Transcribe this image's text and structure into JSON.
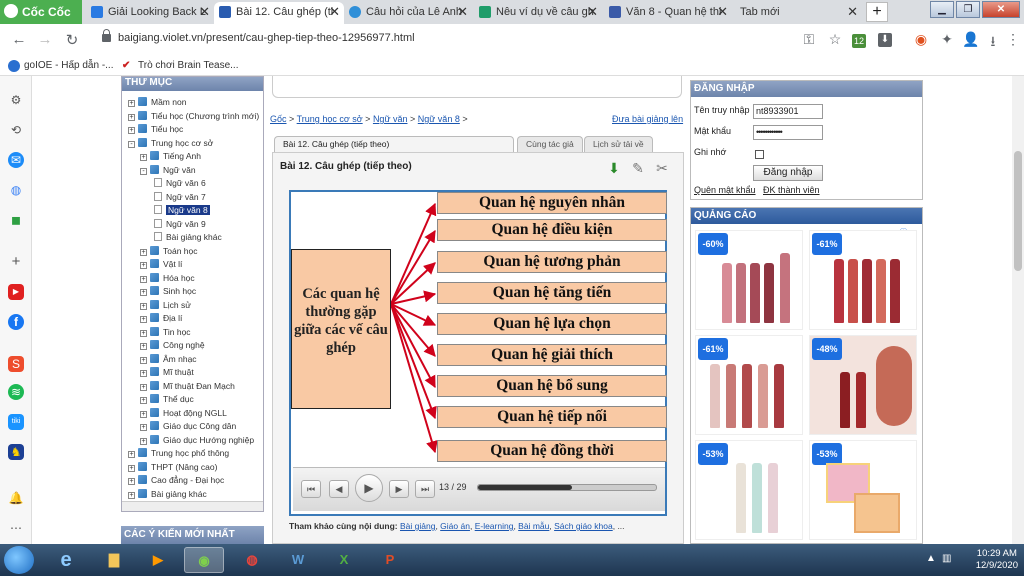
{
  "browser": {
    "brand": "Cốc Cốc",
    "tabs": [
      {
        "label": "Giải Looking Back L",
        "favicon_color": "#2a7ae2"
      },
      {
        "label": "Bài 12. Câu ghép (ti",
        "favicon_color": "#2a5cb0",
        "active": true
      },
      {
        "label": "Câu hỏi của Lê Anh",
        "favicon_color": "#2f8fd8"
      },
      {
        "label": "Nêu ví dụ về câu gh",
        "favicon_color": "#1f9d6a"
      },
      {
        "label": "Văn 8 - Quan hệ thi",
        "favicon_color": "#3a5aa8"
      },
      {
        "label": "Tab mới",
        "favicon_color": ""
      }
    ],
    "new_tab": "+",
    "url": "baigiang.violet.vn/present/cau-ghep-tiep-theo-12956977.html",
    "bookmarks": [
      {
        "label": "goIOE - Hấp dẫn -..."
      },
      {
        "label": "Trò chơi Brain Tease..."
      }
    ],
    "bookmark_counter": "12"
  },
  "directory": {
    "title": "THƯ MỤC",
    "items": [
      {
        "label": "Mầm non",
        "level": 0,
        "exp": "+"
      },
      {
        "label": "Tiểu học (Chương trình mới)",
        "level": 0,
        "exp": "+"
      },
      {
        "label": "Tiểu học",
        "level": 0,
        "exp": "+"
      },
      {
        "label": "Trung học cơ sở",
        "level": 0,
        "exp": "-"
      },
      {
        "label": "Tiếng Anh",
        "level": 1,
        "exp": "+"
      },
      {
        "label": "Ngữ văn",
        "level": 1,
        "exp": "-"
      },
      {
        "label": "Ngữ văn 6",
        "level": 2,
        "exp": ""
      },
      {
        "label": "Ngữ văn 7",
        "level": 2,
        "exp": ""
      },
      {
        "label": "Ngữ văn 8",
        "level": 2,
        "exp": "",
        "selected": true
      },
      {
        "label": "Ngữ văn 9",
        "level": 2,
        "exp": ""
      },
      {
        "label": "Bài giảng khác",
        "level": 2,
        "exp": ""
      },
      {
        "label": "Toán học",
        "level": 1,
        "exp": "+"
      },
      {
        "label": "Vật lí",
        "level": 1,
        "exp": "+"
      },
      {
        "label": "Hóa học",
        "level": 1,
        "exp": "+"
      },
      {
        "label": "Sinh học",
        "level": 1,
        "exp": "+"
      },
      {
        "label": "Lịch sử",
        "level": 1,
        "exp": "+"
      },
      {
        "label": "Địa lí",
        "level": 1,
        "exp": "+"
      },
      {
        "label": "Tin học",
        "level": 1,
        "exp": "+"
      },
      {
        "label": "Công nghệ",
        "level": 1,
        "exp": "+"
      },
      {
        "label": "Âm nhạc",
        "level": 1,
        "exp": "+"
      },
      {
        "label": "Mĩ thuật",
        "level": 1,
        "exp": "+"
      },
      {
        "label": "Mĩ thuật Đan Mạch",
        "level": 1,
        "exp": "+"
      },
      {
        "label": "Thể dục",
        "level": 1,
        "exp": "+"
      },
      {
        "label": "Hoạt động NGLL",
        "level": 1,
        "exp": "+"
      },
      {
        "label": "Giáo dục Công dân",
        "level": 1,
        "exp": "+"
      },
      {
        "label": "Giáo dục Hướng nghiệp",
        "level": 1,
        "exp": "+"
      },
      {
        "label": "Trung học phổ thông",
        "level": 0,
        "exp": "+"
      },
      {
        "label": "THPT (Nâng cao)",
        "level": 0,
        "exp": "+"
      },
      {
        "label": "Cao đẳng - Đại học",
        "level": 0,
        "exp": "+"
      },
      {
        "label": "Bài giảng khác",
        "level": 0,
        "exp": "+"
      }
    ],
    "comments_title": "CÁC Ý KIẾN MỚI NHẤT"
  },
  "breadcrumb": {
    "items": [
      "Gốc",
      "Trung học cơ sở",
      "Ngữ văn",
      "Ngữ văn 8"
    ],
    "sep": ">",
    "upload": "Đưa bài giảng lên"
  },
  "tabs": [
    "Bài 12. Câu ghép (tiếp theo)",
    "Cùng tác giả",
    "Lịch sử tải về"
  ],
  "lesson": {
    "title": "Bài 12. Câu ghép (tiếp theo)",
    "slide": {
      "central": "Các quan hệ thường gặp giữa các vế câu ghép",
      "relations": [
        "Quan hệ nguyên nhân",
        "Quan hệ điều kiện",
        "Quan hệ tương phản",
        "Quan hệ tăng tiến",
        "Quan hệ lựa chọn",
        "Quan hệ giải thích",
        "Quan hệ bổ sung",
        "Quan hệ tiếp nối",
        "Quan hệ đồng thời"
      ],
      "box_color": "#f9c9a4",
      "arrow_color": "#d0021b"
    },
    "player": {
      "counter": "13 / 29",
      "current": 13,
      "total": 29,
      "progress": 0.53
    },
    "related_label": "Tham khảo cùng nội dung:",
    "related_links": [
      "Bài giảng",
      "Giáo án",
      "E-learning",
      "Bài mẫu",
      "Sách giáo khoa",
      "..."
    ]
  },
  "login": {
    "title": "ĐĂNG NHẬP",
    "username_label": "Tên truy nhập",
    "username_value": "nt8933901",
    "password_label": "Mật khẩu",
    "password_value": "••••••••••••",
    "remember_label": "Ghi nhớ",
    "submit": "Đăng nhập",
    "forgot": "Quên mật khẩu",
    "register": "ĐK thành viên"
  },
  "ads": {
    "title": "QUẢNG CÁO",
    "items": [
      {
        "badge": "-60%"
      },
      {
        "badge": "-61%"
      },
      {
        "badge": "-61%"
      },
      {
        "badge": "-48%"
      },
      {
        "badge": "-53%"
      },
      {
        "badge": "-53%"
      }
    ]
  },
  "taskbar": {
    "time": "10:29 AM",
    "date": "12/9/2020"
  }
}
